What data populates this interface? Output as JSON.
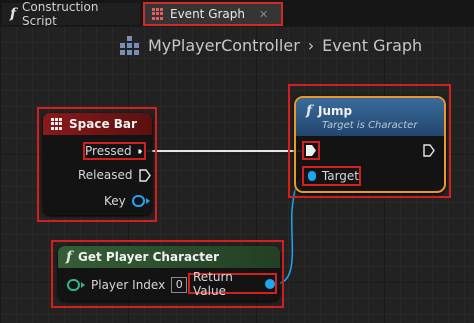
{
  "tabs": [
    {
      "label": "Construction Script",
      "icon": "function-icon"
    },
    {
      "label": "Event Graph",
      "icon": "event-graph-icon"
    }
  ],
  "breadcrumb": {
    "controller": "MyPlayerController",
    "separator": "›",
    "graph": "Event Graph"
  },
  "space_bar_node": {
    "title": "Space Bar",
    "pins": {
      "pressed": "Pressed",
      "released": "Released",
      "key": "Key"
    }
  },
  "jump_node": {
    "title": "Jump",
    "subtitle": "Target is Character",
    "pins": {
      "target": "Target"
    }
  },
  "get_player_character_node": {
    "title": "Get Player Character",
    "player_index_label": "Player Index",
    "player_index_value": "0",
    "return_label": "Return Value"
  },
  "colors": {
    "highlight": "#d41f1f",
    "jump_border": "#e69a2a",
    "jump_header": "#2d5a8a",
    "function_header": "#2f5330",
    "input_header": "#7a1616",
    "object_pin": "#1ea6f0",
    "int_pin": "#2fb58a",
    "exec_wire": "#e6e6e6"
  }
}
